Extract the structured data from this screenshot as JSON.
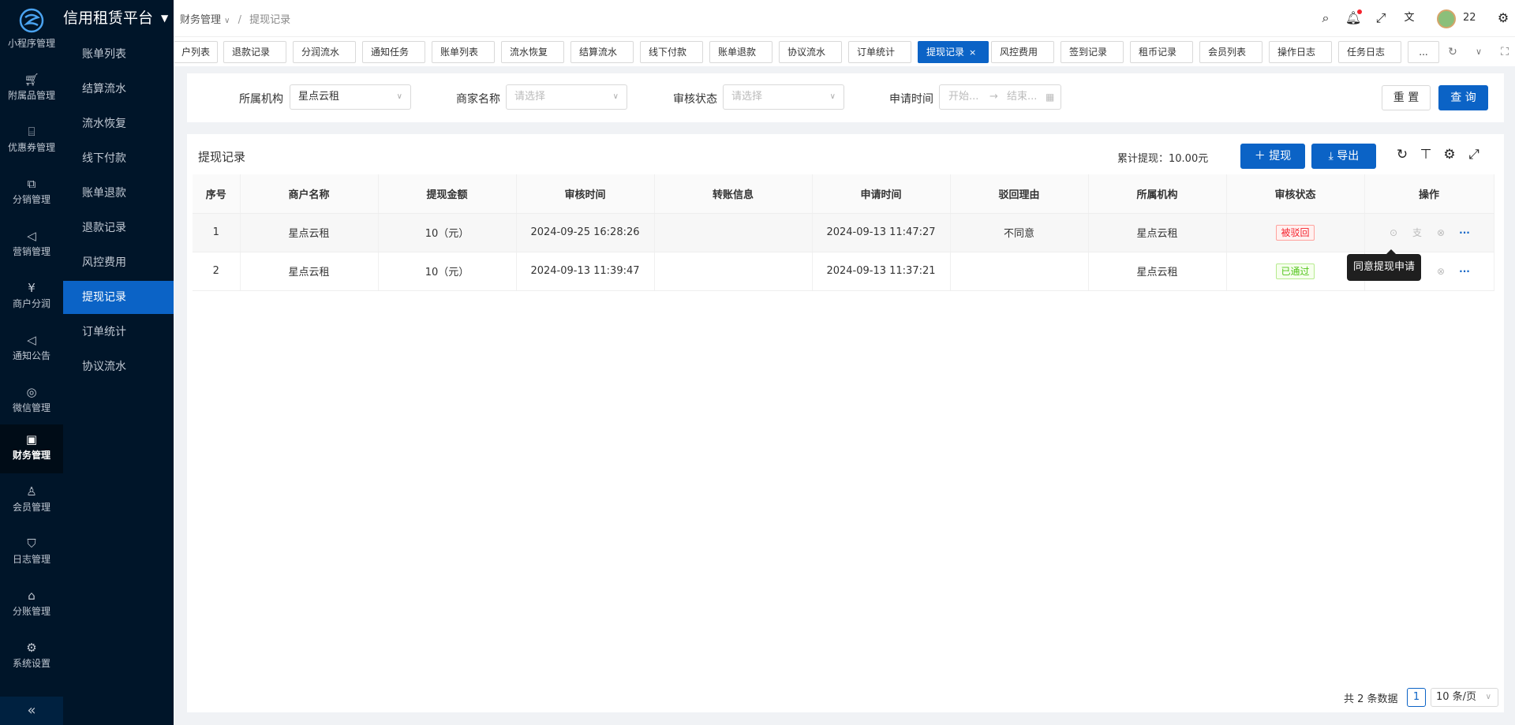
{
  "brand": {
    "title": "信用租赁平台"
  },
  "rail": {
    "items": [
      {
        "label": "小程序管理",
        "icon": "mini-program-icon"
      },
      {
        "label": "附属品管理",
        "icon": "cart-icon"
      },
      {
        "label": "优惠券管理",
        "icon": "gift-icon"
      },
      {
        "label": "分销管理",
        "icon": "share-icon"
      },
      {
        "label": "营销管理",
        "icon": "megaphone-icon"
      },
      {
        "label": "商户分润",
        "icon": "yen-icon"
      },
      {
        "label": "通知公告",
        "icon": "bullhorn-icon"
      },
      {
        "label": "微信管理",
        "icon": "wechat-icon"
      },
      {
        "label": "财务管理",
        "icon": "finance-icon"
      },
      {
        "label": "会员管理",
        "icon": "user-icon"
      },
      {
        "label": "日志管理",
        "icon": "shield-icon"
      },
      {
        "label": "分账管理",
        "icon": "split-icon"
      },
      {
        "label": "系统设置",
        "icon": "gear-icon"
      }
    ],
    "collapse": "«"
  },
  "submenu": {
    "items": [
      "账单列表",
      "结算流水",
      "流水恢复",
      "线下付款",
      "账单退款",
      "退款记录",
      "风控费用",
      "提现记录",
      "订单统计",
      "协议流水"
    ],
    "active": "提现记录"
  },
  "breadcrumb": {
    "parent": "财务管理",
    "separator": "/",
    "current": "提现记录"
  },
  "header": {
    "user": "22"
  },
  "tabs": [
    "户列表",
    "退款记录",
    "分润流水",
    "通知任务",
    "账单列表",
    "流水恢复",
    "结算流水",
    "线下付款",
    "账单退款",
    "协议流水",
    "订单统计",
    "提现记录",
    "风控费用",
    "签到记录",
    "租币记录",
    "会员列表",
    "操作日志",
    "任务日志",
    "..."
  ],
  "filter": {
    "org_label": "所属机构",
    "org_value": "星点云租",
    "merchant_label": "商家名称",
    "merchant_placeholder": "请选择",
    "status_label": "审核状态",
    "status_placeholder": "请选择",
    "date_label": "申请时间",
    "date_start": "开始...",
    "date_arrow": "→",
    "date_end": "结束...",
    "reset": "重 置",
    "search": "查 询"
  },
  "card": {
    "title": "提现记录",
    "total": "累计提现：10.00元",
    "withdraw_btn": "＋ 提现",
    "export_btn": "⤓ 导出"
  },
  "table": {
    "columns": [
      "序号",
      "商户名称",
      "提现金额",
      "审核时间",
      "转账信息",
      "申请时间",
      "驳回理由",
      "所属机构",
      "审核状态",
      "操作"
    ],
    "rows": [
      {
        "no": "1",
        "merchant": "星点云租",
        "amount": "10（元）",
        "audit_time": "2024-09-25 16:28:26",
        "transfer": "",
        "apply_time": "2024-09-13 11:47:27",
        "reason": "不同意",
        "org": "星点云租",
        "status": "被驳回"
      },
      {
        "no": "2",
        "merchant": "星点云租",
        "amount": "10（元）",
        "audit_time": "2024-09-13 11:39:47",
        "transfer": "",
        "apply_time": "2024-09-13 11:37:21",
        "reason": "",
        "org": "星点云租",
        "status": "已通过"
      }
    ]
  },
  "tooltip": "同意提现申请",
  "pager": {
    "total": "共 2 条数据",
    "page": "1",
    "size": "10 条/页"
  },
  "colors": {
    "primary": "#0b63c6",
    "sidebar": "#001529",
    "reject": "#f5222d",
    "pass": "#52c41a"
  }
}
